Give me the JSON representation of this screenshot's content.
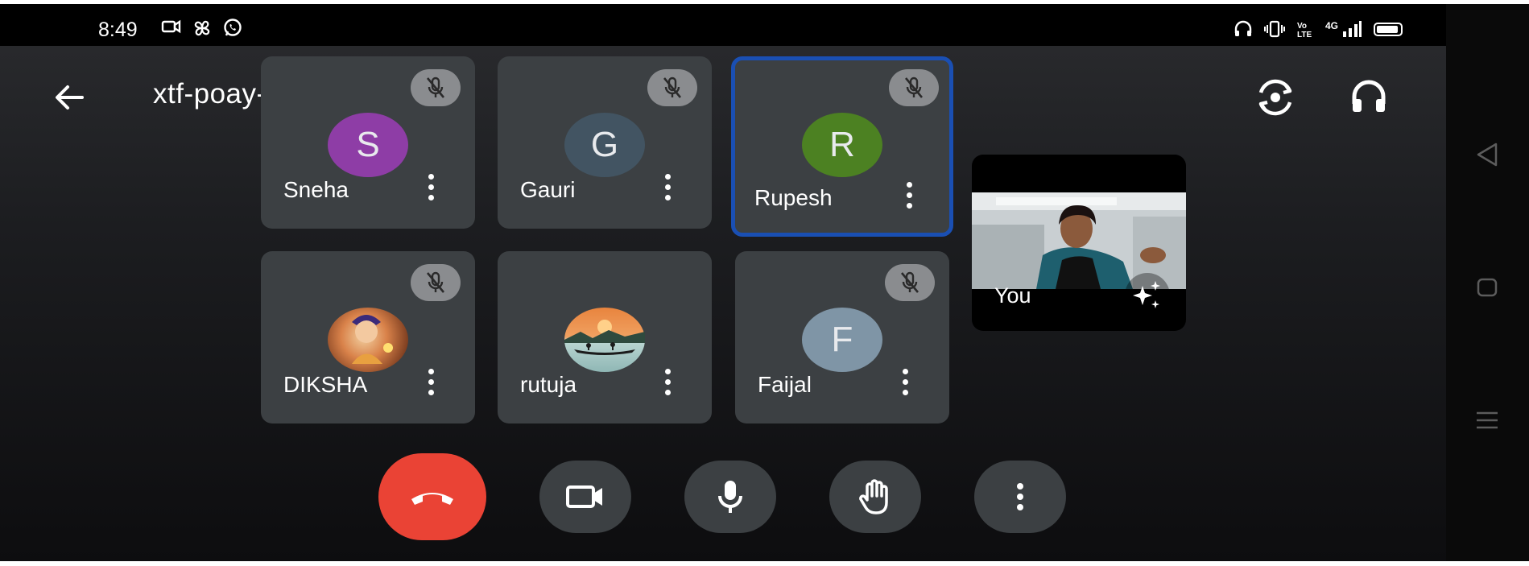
{
  "status_bar": {
    "time": "8:49",
    "left_icons": [
      "video-call-icon",
      "pinwheel-icon",
      "whatsapp-icon"
    ],
    "right_icons": [
      "headset-icon",
      "vibrate-icon",
      "volte-icon",
      "signal-4g-icon",
      "battery-icon"
    ],
    "network_label": "4G"
  },
  "header": {
    "meeting_code": "xtf-poay-cbm"
  },
  "participants": [
    {
      "name": "Sneha",
      "initial": "S",
      "avatar_color": "#8e3da6",
      "muted": true,
      "active": false
    },
    {
      "name": "Gauri",
      "initial": "G",
      "avatar_color": "#425462",
      "muted": true,
      "active": false
    },
    {
      "name": "Rupesh",
      "initial": "R",
      "avatar_color": "#4c8122",
      "muted": true,
      "active": true
    },
    {
      "name": "DIKSHA",
      "initial": "",
      "avatar_color": "#a0522d",
      "muted": true,
      "active": false
    },
    {
      "name": "rutuja",
      "initial": "",
      "avatar_color": "#e38a52",
      "muted": false,
      "active": false
    },
    {
      "name": "Faijal",
      "initial": "F",
      "avatar_color": "#7f95a6",
      "muted": true,
      "active": false
    }
  ],
  "self_view": {
    "label": "You"
  },
  "controls": [
    "end-call-button",
    "camera-button",
    "microphone-button",
    "raise-hand-button",
    "more-options-button"
  ],
  "colors": {
    "end_call": "#ea4335",
    "active_speaker_border": "#1a4fb3",
    "tile_bg": "#3c4043"
  }
}
